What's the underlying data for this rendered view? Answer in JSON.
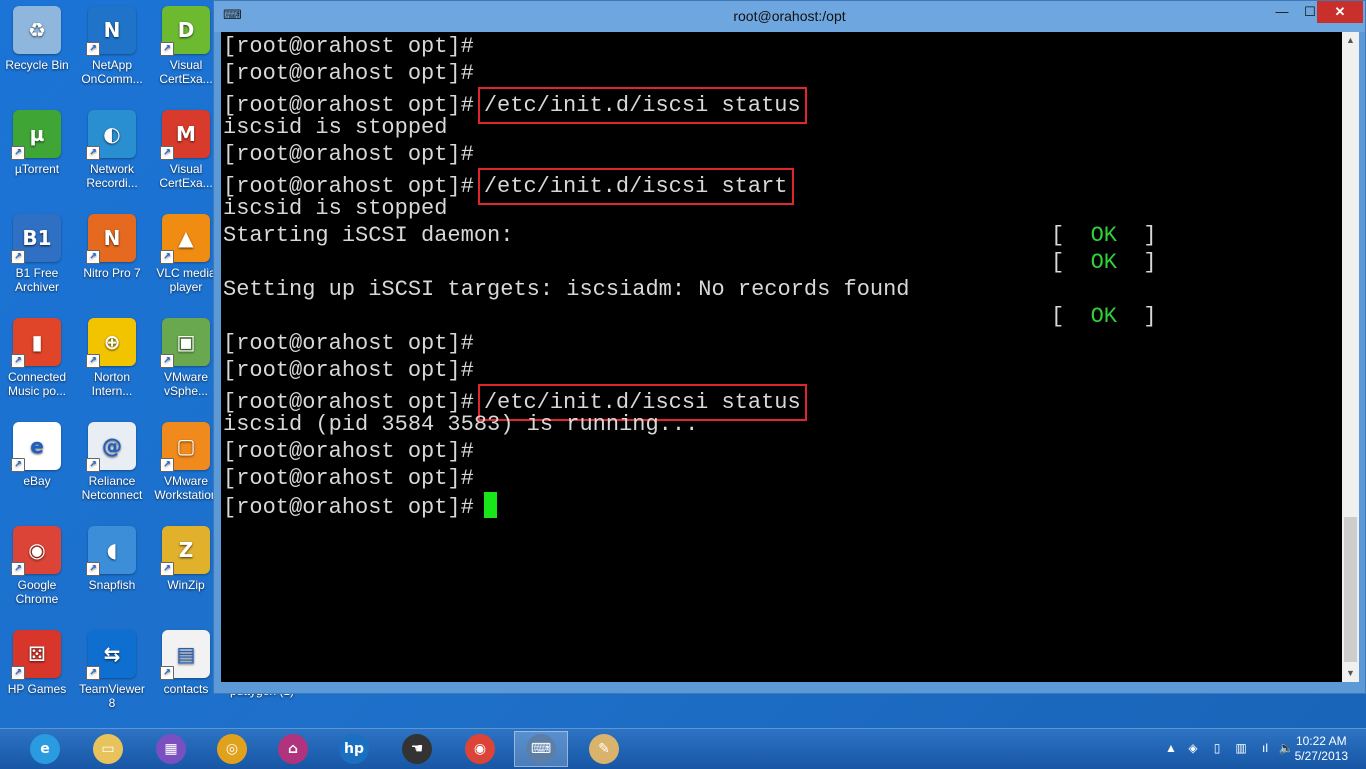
{
  "desktop": {
    "icons": [
      {
        "label": "Recycle Bin",
        "icon": "recycle-bin-icon",
        "color": "#8fb6dd",
        "glyph": "♻"
      },
      {
        "label": "NetApp OnComm...",
        "icon": "netapp-icon",
        "color": "#1f74c9",
        "glyph": "N"
      },
      {
        "label": "Visual CertExa...",
        "icon": "visual-certexam-icon",
        "color": "#6dba31",
        "glyph": "D"
      },
      {
        "label": "µTorrent",
        "icon": "utorrent-icon",
        "color": "#3fa534",
        "glyph": "µ"
      },
      {
        "label": "Network Recordi...",
        "icon": "network-recording-icon",
        "color": "#2a8fd1",
        "glyph": "◐"
      },
      {
        "label": "Visual CertExa...",
        "icon": "visual-certexam-manager-icon",
        "color": "#d83a2b",
        "glyph": "M"
      },
      {
        "label": "B1 Free Archiver",
        "icon": "b1-archiver-icon",
        "color": "#2f6fc4",
        "glyph": "B1"
      },
      {
        "label": "Nitro Pro 7",
        "icon": "nitro-pro-icon",
        "color": "#e56a1f",
        "glyph": "N"
      },
      {
        "label": "VLC media player",
        "icon": "vlc-icon",
        "color": "#f08c12",
        "glyph": "▲"
      },
      {
        "label": "Connected Music po...",
        "icon": "connected-music-icon",
        "color": "#e0452a",
        "glyph": "▮"
      },
      {
        "label": "Norton Intern...",
        "icon": "norton-icon",
        "color": "#f2c400",
        "glyph": "⊕"
      },
      {
        "label": "VMware vSphe...",
        "icon": "vmware-vsphere-icon",
        "color": "#6aa84f",
        "glyph": "▣"
      },
      {
        "label": "eBay",
        "icon": "ebay-icon",
        "color": "#ffffff",
        "glyph": "e"
      },
      {
        "label": "Reliance Netconnect",
        "icon": "reliance-netconnect-icon",
        "color": "#e9eef5",
        "glyph": "@"
      },
      {
        "label": "VMware Workstation",
        "icon": "vmware-workstation-icon",
        "color": "#f08a1c",
        "glyph": "▢"
      },
      {
        "label": "Google Chrome",
        "icon": "chrome-icon",
        "color": "#db4437",
        "glyph": "◉"
      },
      {
        "label": "Snapfish",
        "icon": "snapfish-icon",
        "color": "#3c8ed8",
        "glyph": "◖"
      },
      {
        "label": "WinZip",
        "icon": "winzip-icon",
        "color": "#e1b12c",
        "glyph": "Z"
      },
      {
        "label": "HP Games",
        "icon": "hp-games-icon",
        "color": "#d9362b",
        "glyph": "⚄"
      },
      {
        "label": "TeamViewer 8",
        "icon": "teamviewer-icon",
        "color": "#0e6fd0",
        "glyph": "⇆"
      },
      {
        "label": "contacts",
        "icon": "contacts-file-icon",
        "color": "#f2f2f2",
        "glyph": "▤"
      }
    ],
    "overflow_label": "puttygen (1)"
  },
  "window": {
    "title": "root@orahost:/opt",
    "app_icon": "putty-icon",
    "minimize": "—",
    "maximize": "☐",
    "close": "✕"
  },
  "terminal": {
    "prompt": "[root@orahost opt]#",
    "lines": [
      {
        "prompt": "[root@orahost opt]#"
      },
      {
        "prompt": "[root@orahost opt]#"
      },
      {
        "prompt": "[root@orahost opt]#",
        "cmd": "/etc/init.d/iscsi status"
      },
      {
        "text": "iscsid is stopped"
      },
      {
        "prompt": "[root@orahost opt]#"
      },
      {
        "prompt": "[root@orahost opt]#",
        "cmd": "/etc/init.d/iscsi start"
      },
      {
        "text": "iscsid is stopped"
      },
      {
        "text": "Starting iSCSI daemon:",
        "ok": "OK"
      },
      {
        "text": "",
        "ok": "OK"
      },
      {
        "text": "Setting up iSCSI targets: iscsiadm: No records found"
      },
      {
        "text": "",
        "ok": "OK"
      },
      {
        "prompt": "[root@orahost opt]#"
      },
      {
        "prompt": "[root@orahost opt]#"
      },
      {
        "prompt": "[root@orahost opt]#",
        "cmd": "/etc/init.d/iscsi status"
      },
      {
        "text": "iscsid (pid 3584 3583) is running..."
      },
      {
        "prompt": "[root@orahost opt]#"
      },
      {
        "prompt": "[root@orahost opt]#"
      },
      {
        "prompt": "[root@orahost opt]#",
        "cursor": true
      }
    ],
    "ok_open": "[",
    "ok_close": "]"
  },
  "taskbar": {
    "items": [
      {
        "icon": "internet-explorer-icon",
        "glyph": "e",
        "color": "#2a9be0"
      },
      {
        "icon": "file-explorer-icon",
        "glyph": "▭",
        "color": "#e8c25a"
      },
      {
        "icon": "windows-store-apps-icon",
        "glyph": "▦",
        "color": "#7a4fbf"
      },
      {
        "icon": "media-player-icon",
        "glyph": "◎",
        "color": "#e0a21c"
      },
      {
        "icon": "network-projector-icon",
        "glyph": "⌂",
        "color": "#b1337e"
      },
      {
        "icon": "hp-icon",
        "glyph": "hp",
        "color": "#1b6fc1"
      },
      {
        "icon": "touch-app-icon",
        "glyph": "☚",
        "color": "#333333"
      },
      {
        "icon": "chrome-taskbar-icon",
        "glyph": "◉",
        "color": "#db4437"
      },
      {
        "icon": "putty-taskbar-icon",
        "glyph": "⌨",
        "color": "#5c7fa8"
      },
      {
        "icon": "paint-icon",
        "glyph": "✎",
        "color": "#d9b36c"
      }
    ],
    "tray": [
      {
        "icon": "show-hidden-icons-icon",
        "glyph": "▲"
      },
      {
        "icon": "network-status-icon",
        "glyph": "◈"
      },
      {
        "icon": "device-icon",
        "glyph": "▯"
      },
      {
        "icon": "network-icon",
        "glyph": "▥"
      },
      {
        "icon": "wifi-icon",
        "glyph": "ıl"
      },
      {
        "icon": "volume-muted-icon",
        "glyph": "🔈"
      }
    ],
    "time": "10:22 AM",
    "date": "5/27/2013"
  },
  "colors": {
    "desktop": "#1e6fc8",
    "terminal_bg": "#000000",
    "terminal_text": "#d8d8d8",
    "ok_green": "#2fd03a",
    "cursor": "#19e619",
    "highlight_box": "#e0262c"
  }
}
